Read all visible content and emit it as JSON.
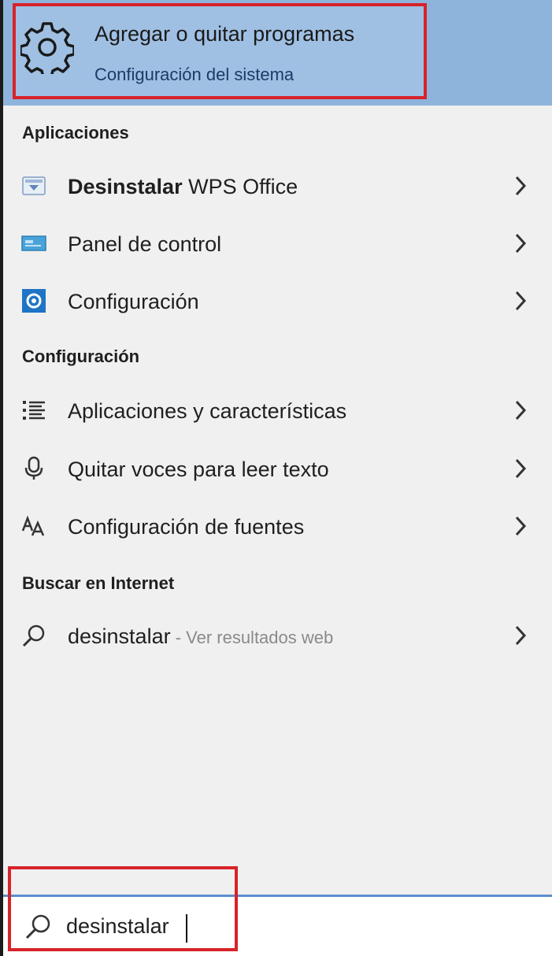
{
  "best_match": {
    "title": "Agregar o quitar programas",
    "subtitle": "Configuración del sistema",
    "icon": "gear-icon"
  },
  "sections": {
    "apps": {
      "header": "Aplicaciones",
      "items": [
        {
          "bold": "Desinstalar",
          "rest": " WPS Office",
          "icon": "wps-uninstall-icon"
        },
        {
          "bold": "",
          "rest": "Panel de control",
          "icon": "control-panel-icon"
        },
        {
          "bold": "",
          "rest": "Configuración",
          "icon": "settings-app-icon"
        }
      ]
    },
    "settings": {
      "header": "Configuración",
      "items": [
        {
          "label": "Aplicaciones y características",
          "icon": "apps-list-icon"
        },
        {
          "label": "Quitar voces para leer texto",
          "icon": "microphone-icon"
        },
        {
          "label": "Configuración de fuentes",
          "icon": "font-icon"
        }
      ]
    },
    "web": {
      "header": "Buscar en Internet",
      "items": [
        {
          "query": "desinstalar",
          "hint": " - Ver resultados web",
          "icon": "search-icon"
        }
      ]
    }
  },
  "search": {
    "value": "desinstalar",
    "icon": "search-icon"
  },
  "colors": {
    "highlight": "#8fb4dc",
    "annotation_red": "#d8232a",
    "accent_blue": "#5b8fcf"
  }
}
